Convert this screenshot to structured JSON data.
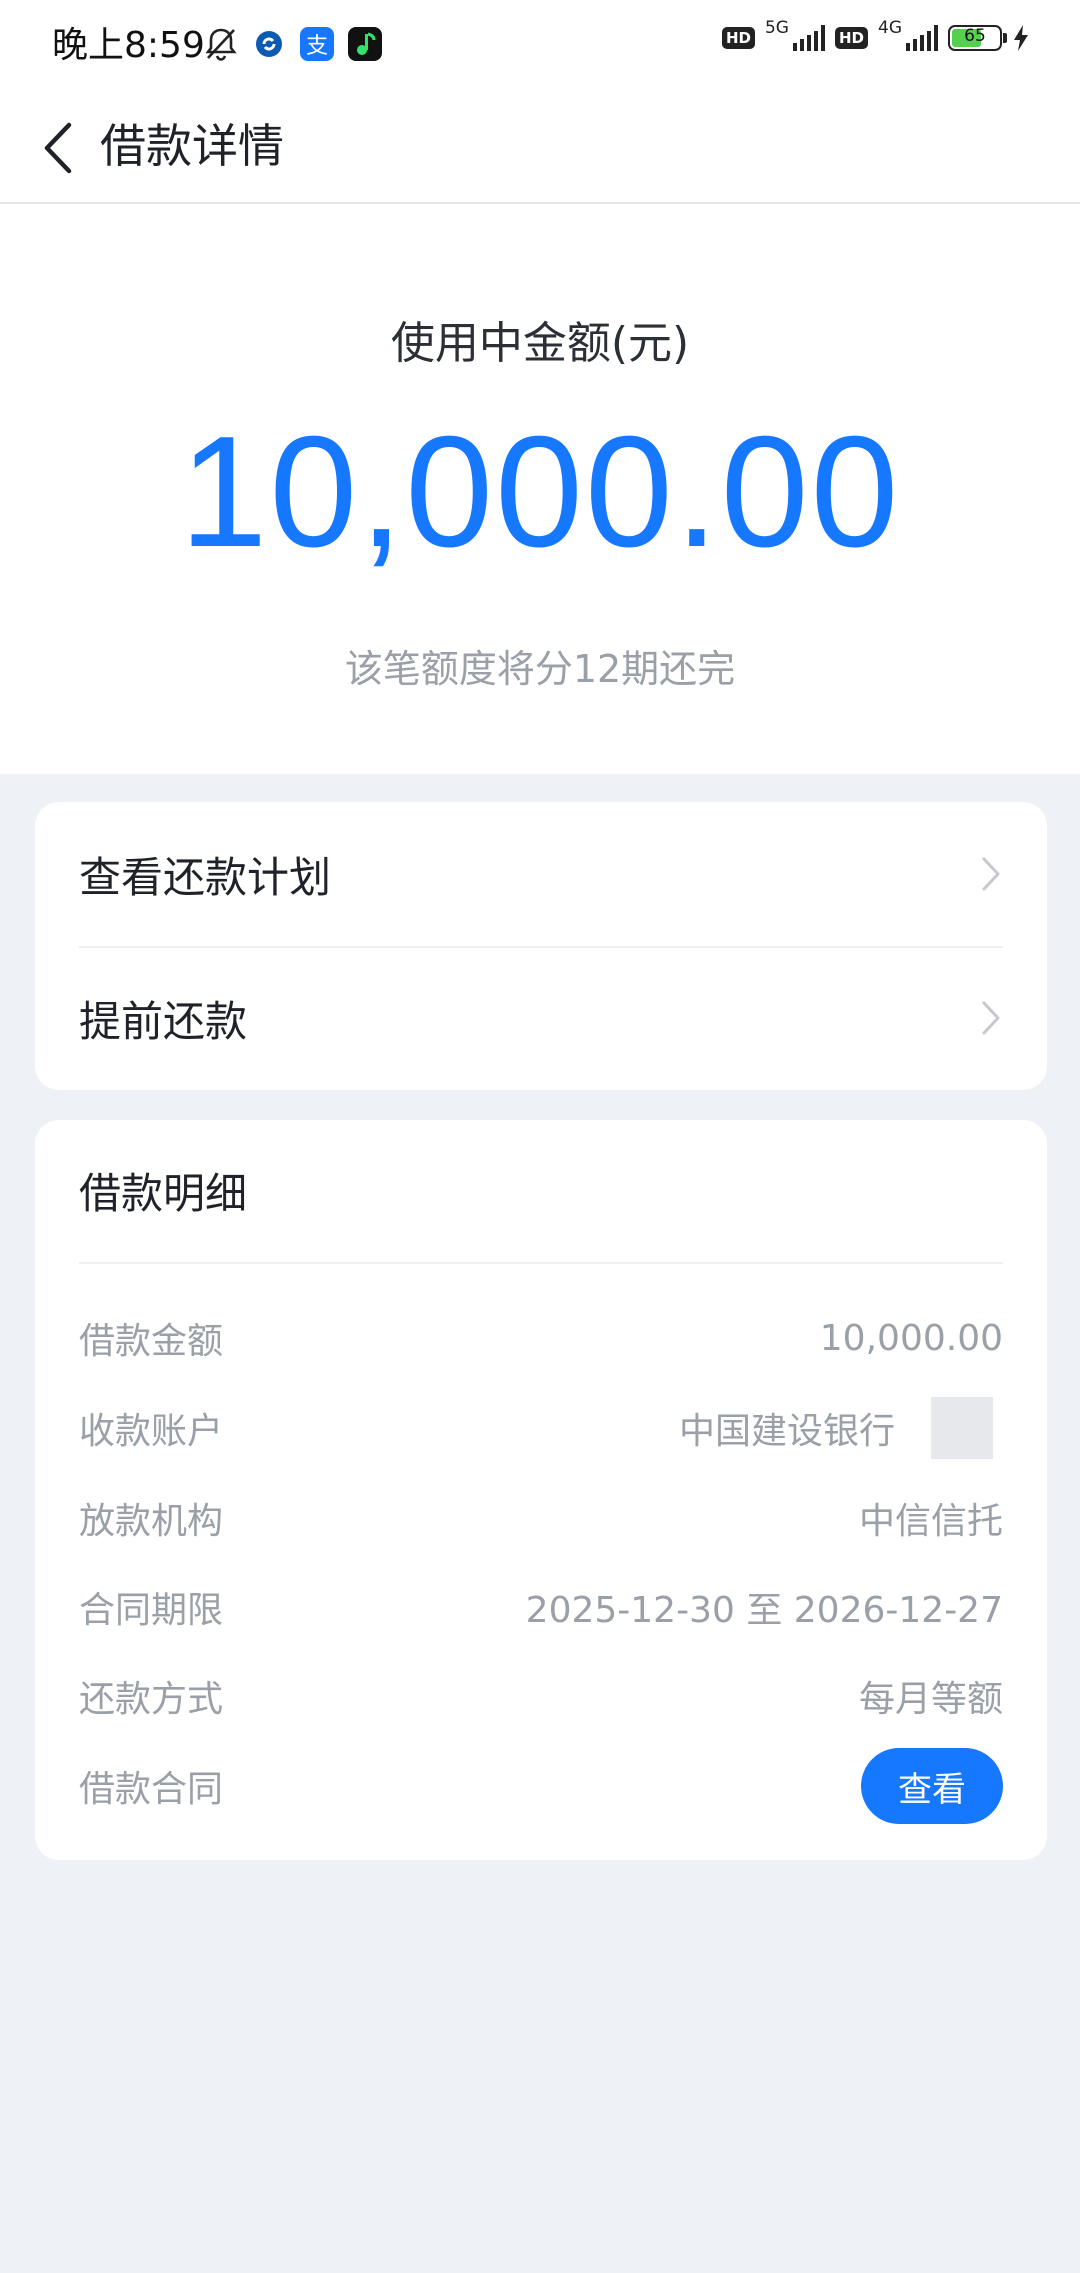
{
  "status_bar": {
    "time": "晚上8:59",
    "net1": "5G",
    "net2": "4G",
    "hd": "HD",
    "battery": "65"
  },
  "header": {
    "title": "借款详情"
  },
  "summary": {
    "label": "使用中金额(元)",
    "amount": "10,000.00",
    "subtitle": "该笔额度将分12期还完"
  },
  "actions": [
    {
      "label": "查看还款计划"
    },
    {
      "label": "提前还款"
    }
  ],
  "details": {
    "title": "借款明细",
    "rows": [
      {
        "key": "借款金额",
        "value": "10,000.00"
      },
      {
        "key": "收款账户",
        "value": "中国建设银行"
      },
      {
        "key": "放款机构",
        "value": "中信信托"
      },
      {
        "key": "合同期限",
        "value": "2025-12-30 至 2026-12-27"
      },
      {
        "key": "还款方式",
        "value": "每月等额"
      },
      {
        "key": "借款合同",
        "button": "查看"
      }
    ]
  },
  "colors": {
    "accent": "#1677ff",
    "background": "#eef1f6",
    "muted_text": "#9aa0a8",
    "battery_fill": "#55d14f"
  },
  "icons": {
    "back": "chevron-left-icon",
    "row_arrow": "chevron-right-icon",
    "mute": "bell-off-icon"
  }
}
